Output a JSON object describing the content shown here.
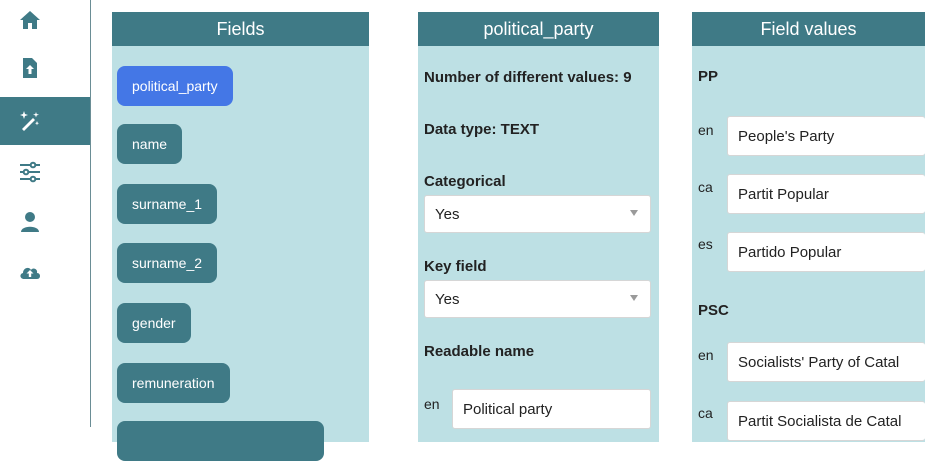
{
  "nav": [
    {
      "icon": "home-icon"
    },
    {
      "icon": "upload-file-icon"
    },
    {
      "icon": "magic-wand-icon",
      "active": true
    },
    {
      "icon": "sliders-icon"
    },
    {
      "icon": "user-icon"
    },
    {
      "icon": "cloud-upload-icon"
    }
  ],
  "fields_panel": {
    "title": "Fields",
    "items": [
      "political_party",
      "name",
      "surname_1",
      "surname_2",
      "gender",
      "remuneration"
    ]
  },
  "field_panel": {
    "title": "political_party",
    "num_values": "Number of different values: 9",
    "data_type": "Data type: TEXT",
    "categorical_label": "Categorical",
    "categorical_value": "Yes",
    "key_field_label": "Key field",
    "key_field_value": "Yes",
    "readable_name_label": "Readable name",
    "readable_lang": "en",
    "readable_value": "Political party"
  },
  "values_panel": {
    "title": "Field values",
    "groups": [
      {
        "code": "PP",
        "entries": [
          {
            "lang": "en",
            "value": "People's Party"
          },
          {
            "lang": "ca",
            "value": "Partit Popular"
          },
          {
            "lang": "es",
            "value": "Partido Popular"
          }
        ]
      },
      {
        "code": "PSC",
        "entries": [
          {
            "lang": "en",
            "value": "Socialists' Party of Catal"
          },
          {
            "lang": "ca",
            "value": "Partit Socialista de Catal"
          }
        ]
      }
    ]
  },
  "colors": {
    "accent": "#3f7a86",
    "panel_bg": "#bde0e4",
    "selected_chip": "#4477e6"
  }
}
